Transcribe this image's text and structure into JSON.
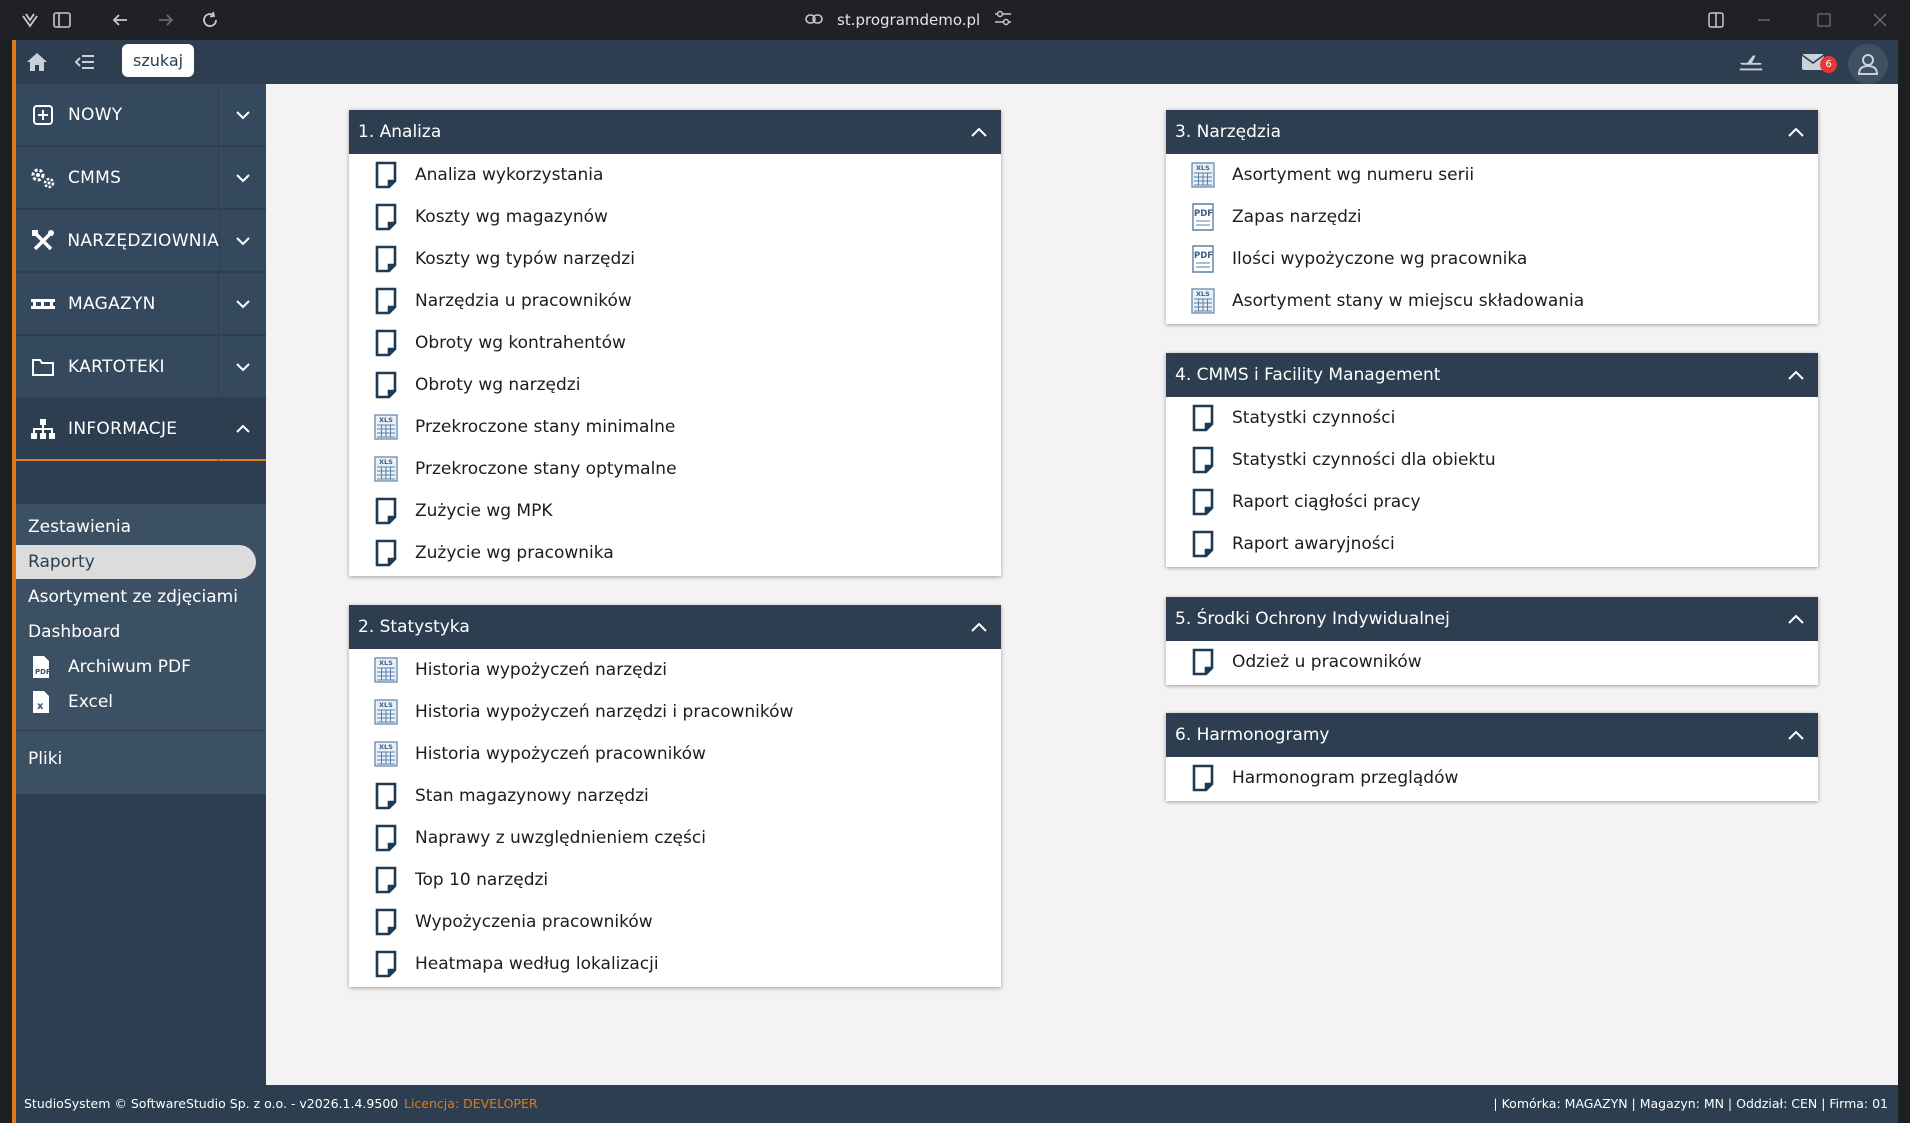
{
  "browser": {
    "url": "st.programdemo.pl"
  },
  "topbar": {
    "search_label": "szukaj",
    "mail_count": "6"
  },
  "sidebar": {
    "menu": [
      {
        "label": "NOWY",
        "icon": "plus-square-icon"
      },
      {
        "label": "CMMS",
        "icon": "gears-icon"
      },
      {
        "label": "NARZĘDZIOWNIA",
        "icon": "tools-icon"
      },
      {
        "label": "MAGAZYN",
        "icon": "warehouse-pallet-icon"
      },
      {
        "label": "KARTOTEKI",
        "icon": "folder-icon"
      },
      {
        "label": "INFORMACJE",
        "icon": "sitemap-icon"
      }
    ],
    "submenu": [
      {
        "label": "Zestawienia"
      },
      {
        "label": "Raporty",
        "active": true
      },
      {
        "label": "Asortyment ze zdjęciami"
      },
      {
        "label": "Dashboard"
      },
      {
        "label": "Archiwum PDF",
        "icon": "pdf-file-icon"
      },
      {
        "label": "Excel",
        "icon": "excel-file-icon"
      },
      {
        "label": "Pliki"
      }
    ]
  },
  "panels": {
    "analiza": {
      "title": "1. Analiza",
      "items": [
        {
          "label": "Analiza wykorzystania",
          "icon": "report-icon"
        },
        {
          "label": "Koszty wg magazynów",
          "icon": "report-icon"
        },
        {
          "label": "Koszty wg typów narzędzi",
          "icon": "report-icon"
        },
        {
          "label": "Narzędzia u pracowników",
          "icon": "report-icon"
        },
        {
          "label": "Obroty wg kontrahentów",
          "icon": "report-icon"
        },
        {
          "label": "Obroty wg narzędzi",
          "icon": "report-icon"
        },
        {
          "label": "Przekroczone stany minimalne",
          "icon": "xls-icon"
        },
        {
          "label": "Przekroczone stany optymalne",
          "icon": "xls-icon"
        },
        {
          "label": "Zużycie wg MPK",
          "icon": "report-icon"
        },
        {
          "label": "Zużycie wg pracownika",
          "icon": "report-icon"
        }
      ]
    },
    "statystyka": {
      "title": "2. Statystyka",
      "items": [
        {
          "label": "Historia wypożyczeń narzędzi",
          "icon": "xls-icon"
        },
        {
          "label": "Historia wypożyczeń narzędzi i pracowników",
          "icon": "xls-icon"
        },
        {
          "label": "Historia wypożyczeń pracowników",
          "icon": "xls-icon"
        },
        {
          "label": "Stan magazynowy narzędzi",
          "icon": "report-icon"
        },
        {
          "label": "Naprawy z uwzględnieniem części",
          "icon": "report-icon"
        },
        {
          "label": "Top 10 narzędzi",
          "icon": "report-icon"
        },
        {
          "label": "Wypożyczenia pracowników",
          "icon": "report-icon"
        },
        {
          "label": "Heatmapa według lokalizacji",
          "icon": "report-icon"
        }
      ]
    },
    "narzedzia": {
      "title": "3. Narzędzia",
      "items": [
        {
          "label": "Asortyment wg numeru serii",
          "icon": "xls-icon"
        },
        {
          "label": "Zapas narzędzi",
          "icon": "pdf-icon"
        },
        {
          "label": "Ilości wypożyczone wg pracownika",
          "icon": "pdf-icon"
        },
        {
          "label": "Asortyment stany w miejscu składowania",
          "icon": "xls-icon"
        }
      ]
    },
    "cmms": {
      "title": "4. CMMS i Facility Management",
      "items": [
        {
          "label": "Statystki czynności",
          "icon": "report-icon"
        },
        {
          "label": "Statystki czynności dla obiektu",
          "icon": "report-icon"
        },
        {
          "label": "Raport ciągłości pracy",
          "icon": "report-icon"
        },
        {
          "label": "Raport awaryjności",
          "icon": "report-icon"
        }
      ]
    },
    "soi": {
      "title": "5. Środki Ochrony Indywidualnej",
      "items": [
        {
          "label": "Odzież u pracowników",
          "icon": "report-icon"
        }
      ]
    },
    "harmonogramy": {
      "title": "6. Harmonogramy",
      "items": [
        {
          "label": "Harmonogram przeglądów",
          "icon": "report-icon"
        }
      ]
    }
  },
  "footer": {
    "copyright": "StudioSystem © SoftwareStudio Sp. z o.o. - v2026.1.4.9500",
    "license": "Licencja: DEVELOPER",
    "context": "| Komórka: MAGAZYN | Magazyn: MN | Oddział: CEN | Firma: 01"
  },
  "colors": {
    "navy": "#2c3e50",
    "accent": "#e07b19",
    "badge": "#e53935"
  }
}
